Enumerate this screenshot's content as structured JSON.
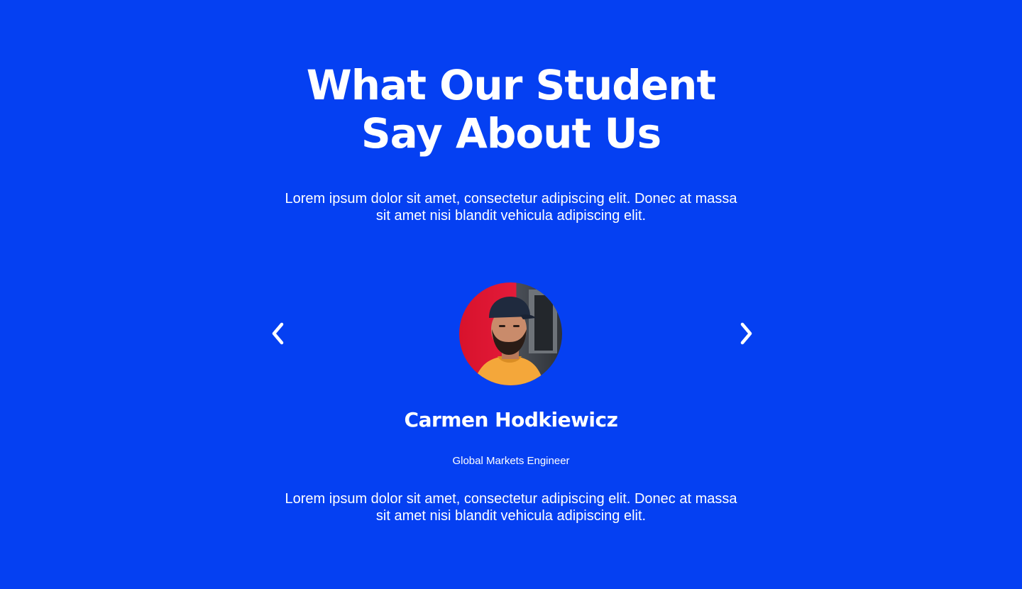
{
  "colors": {
    "background": "#0540F2",
    "text": "#ffffff"
  },
  "header": {
    "title_line1": "What Our Student",
    "title_line2": "Say About Us",
    "subtitle": "Lorem ipsum dolor sit amet, consectetur adipiscing elit. Donec at massa sit amet nisi blandit vehicula adipiscing elit."
  },
  "carousel": {
    "prev_icon": "chevron-left-icon",
    "next_icon": "chevron-right-icon",
    "testimonial": {
      "name": "Carmen Hodkiewicz",
      "role": "Global Markets Engineer",
      "quote": "Lorem ipsum dolor sit amet, consectetur adipiscing elit. Donec at massa sit amet nisi blandit vehicula adipiscing elit."
    }
  }
}
